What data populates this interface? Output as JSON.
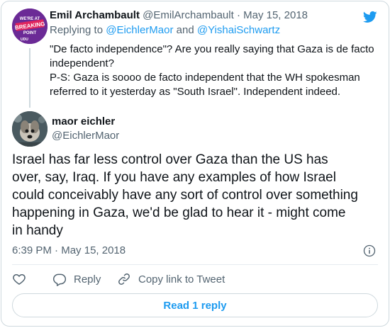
{
  "parent_tweet": {
    "author_name": "Emil Archambault",
    "author_handle": "@EmilArchambault",
    "separator": "·",
    "date": "May 15, 2018",
    "replying_to_label": "Replying to",
    "replying_to_user1": "@EichlerMaor",
    "and_label": "and",
    "replying_to_user2": "@YishaiSchwartz",
    "text_lines": [
      "\"De facto independence\"?  Are you really saying that Gaza is de facto",
      "independent?",
      "P-S: Gaza is soooo de facto independent that the WH spokesman",
      "referred to it yesterday as \"South Israel\".  Independent indeed."
    ],
    "avatar_text_lines": [
      "WE'RE AT",
      "BREAKING",
      "POINT"
    ],
    "avatar_caption": "UDU"
  },
  "tweet": {
    "author_name": "maor eichler",
    "author_handle": "@EichlerMaor",
    "text_lines": [
      "Israel has far less control over Gaza than the US has",
      "over, say, Iraq. If you have any examples of how Israel",
      "could conceivably have any sort of control over something",
      "happening in Gaza, we'd be glad to hear it - might come",
      "in handy"
    ],
    "time": "6:39 PM",
    "separator": "·",
    "date": "May 15, 2018"
  },
  "actions": {
    "reply_label": "Reply",
    "copy_link_label": "Copy link to Tweet"
  },
  "read_more_label": "Read 1 reply",
  "icons": {
    "logo": "twitter-bird-icon",
    "like": "heart-icon",
    "reply": "reply-icon",
    "copy": "link-icon",
    "info": "info-icon"
  },
  "colors": {
    "accent": "#1d9bf0",
    "muted": "#536471",
    "avatar_bg": "#6b2a96"
  }
}
